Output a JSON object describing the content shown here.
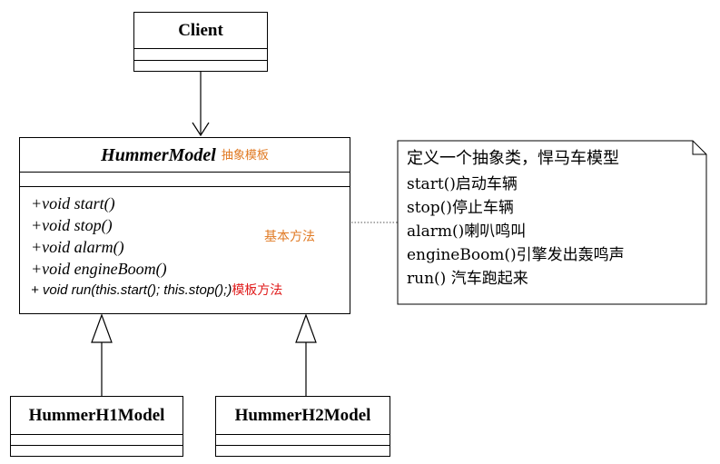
{
  "client": {
    "name": "Client"
  },
  "abstract_class": {
    "name": "HummerModel",
    "tag": "抽象模板",
    "methods": [
      "+void start()",
      "+void stop()",
      "+void alarm()",
      "+void engineBoom()"
    ],
    "template_method": "+ void run(this.start(); this.stop();)",
    "template_label": "模板方法"
  },
  "base_methods_label": "基本方法",
  "subclasses": [
    {
      "name": "HummerH1Model"
    },
    {
      "name": "HummerH2Model"
    }
  ],
  "note": {
    "lines": [
      "定义一个抽象类，悍马车模型",
      "start()启动车辆",
      "stop()停止车辆",
      "alarm()喇叭鸣叫",
      "engineBoom()引擎发出轰鸣声",
      "run() 汽车跑起来"
    ]
  },
  "colors": {
    "orange": "#e07a24",
    "red": "#e01b1b",
    "line": "#000000",
    "dotted": "#555555"
  }
}
